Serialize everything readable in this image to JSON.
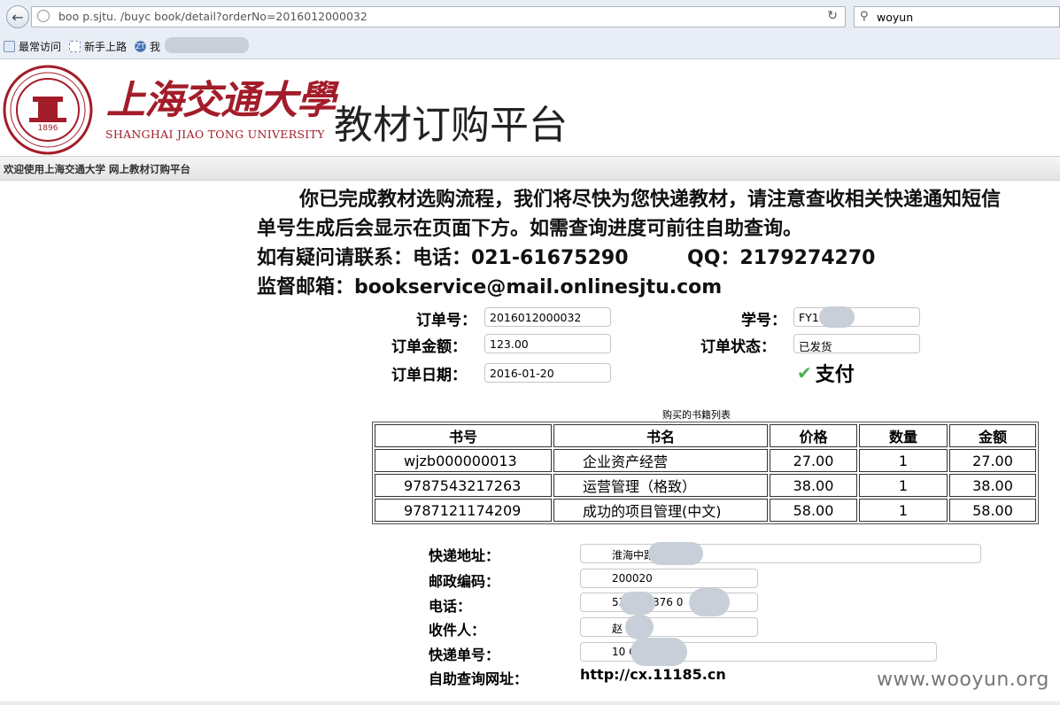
{
  "browser": {
    "url": "boo      p.sjtu.   /buyc      book/detail?orderNo=2016012000032",
    "search_value": "woyun",
    "bookmarks": [
      "最常访问",
      "新手上路",
      "我"
    ]
  },
  "header": {
    "seal_text": "1896",
    "university_cn": "上海交通大學",
    "university_en": "SHANGHAI JIAO TONG UNIVERSITY",
    "platform_title": "教材订购平台",
    "welcome": "欢迎使用上海交通大学 网上教材订购平台"
  },
  "notice": {
    "line1": "你已完成教材选购流程，我们将尽快为您快递教材，请注意查收相关快递通知短信",
    "line2": "单号生成后会显示在页面下方。如需查询进度可前往自助查询。",
    "line3_phone": "如有疑问请联系：电话：021-61675290",
    "line3_qq": "QQ：2179274270",
    "line4": "监督邮箱：bookservice@mail.onlinesjtu.com"
  },
  "order": {
    "order_no_label": "订单号：",
    "order_no": "2016012000032",
    "student_id_label": "学号：",
    "student_id": "FY13        8",
    "amount_label": "订单金额：",
    "amount": "123.00",
    "status_label": "订单状态：",
    "status": "已发货",
    "date_label": "订单日期：",
    "date": "2016-01-20",
    "pay_label": "支付"
  },
  "books": {
    "caption": "购买的书籍列表",
    "headers": [
      "书号",
      "书名",
      "价格",
      "数量",
      "金额"
    ],
    "rows": [
      [
        "wjzb000000013",
        "企业资产经营",
        "27.00",
        "1",
        "27.00"
      ],
      [
        "9787543217263",
        "运营管理（格致）",
        "38.00",
        "1",
        "38.00"
      ],
      [
        "9787121174209",
        "成功的项目管理(中文)",
        "58.00",
        "1",
        "58.00"
      ]
    ]
  },
  "shipping": {
    "address_label": "快递地址：",
    "address": "淮海中路      弄   号",
    "postcode_label": "邮政编码：",
    "postcode": "200020",
    "phone_label": "电话：",
    "phone": "53      52/1376        0",
    "recipient_label": "收件人：",
    "recipient": "赵",
    "tracking_label": "快递单号：",
    "tracking": "10             6",
    "query_label": "自助查询网址：",
    "query_url": "http://cx.11185.cn"
  },
  "watermark": "www.wooyun.org"
}
